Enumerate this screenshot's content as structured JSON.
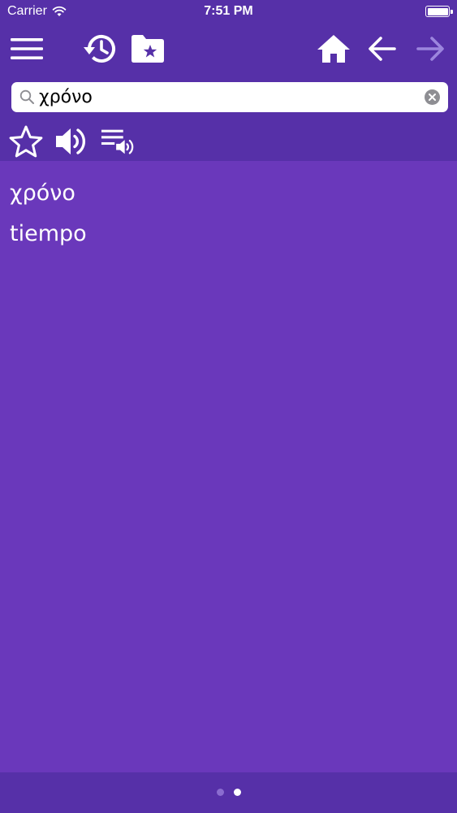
{
  "status_bar": {
    "carrier": "Carrier",
    "time": "7:51 PM",
    "icons": [
      "wifi-icon",
      "battery-icon"
    ]
  },
  "toolbar": {
    "icons": [
      "menu-icon",
      "history-icon",
      "favorites-folder-icon",
      "home-icon",
      "back-arrow-icon",
      "forward-arrow-icon"
    ],
    "forward_enabled": false
  },
  "search": {
    "value": "χρόνο",
    "icons": [
      "search-icon",
      "clear-icon"
    ]
  },
  "actions": {
    "icons": [
      "star-icon",
      "speaker-icon",
      "playlist-audio-icon"
    ]
  },
  "entry": {
    "word": "χρόνο",
    "translation": "tiempo"
  },
  "pager": {
    "pages": 2,
    "current": 2
  },
  "colors": {
    "header": "#5630a8",
    "content": "#6a38bb",
    "text": "#ffffff",
    "disabled": "#9c85de"
  }
}
